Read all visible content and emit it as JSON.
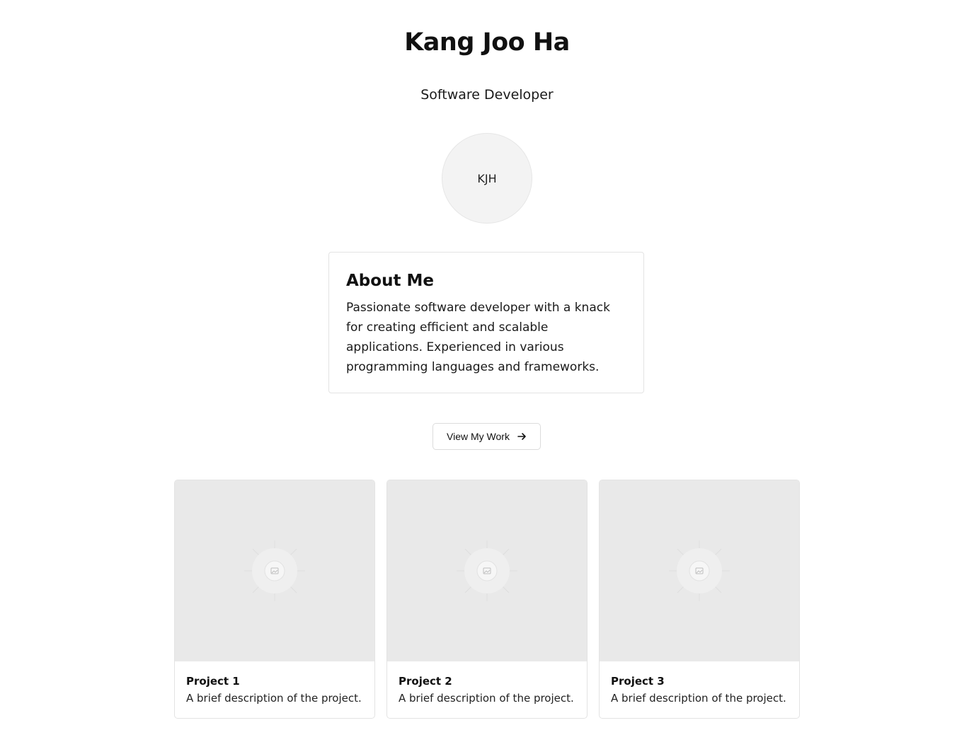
{
  "header": {
    "name": "Kang Joo Ha",
    "role": "Software Developer"
  },
  "avatar": {
    "initials": "KJH"
  },
  "about": {
    "heading": "About Me",
    "text": "Passionate software developer with a knack for creating efficient and scalable applications. Experienced in various programming languages and frameworks."
  },
  "cta": {
    "label": "View My Work",
    "icon": "arrow-right-icon"
  },
  "projects": [
    {
      "title": "Project 1",
      "description": "A brief description of the project.",
      "icon": "image-placeholder-icon"
    },
    {
      "title": "Project 2",
      "description": "A brief description of the project.",
      "icon": "image-placeholder-icon"
    },
    {
      "title": "Project 3",
      "description": "A brief description of the project.",
      "icon": "image-placeholder-icon"
    }
  ],
  "colors": {
    "background": "#ffffff",
    "text": "#111111",
    "border": "#e3e3e3",
    "placeholder": "#e9e9e9",
    "avatar_bg": "#f3f3f3"
  }
}
